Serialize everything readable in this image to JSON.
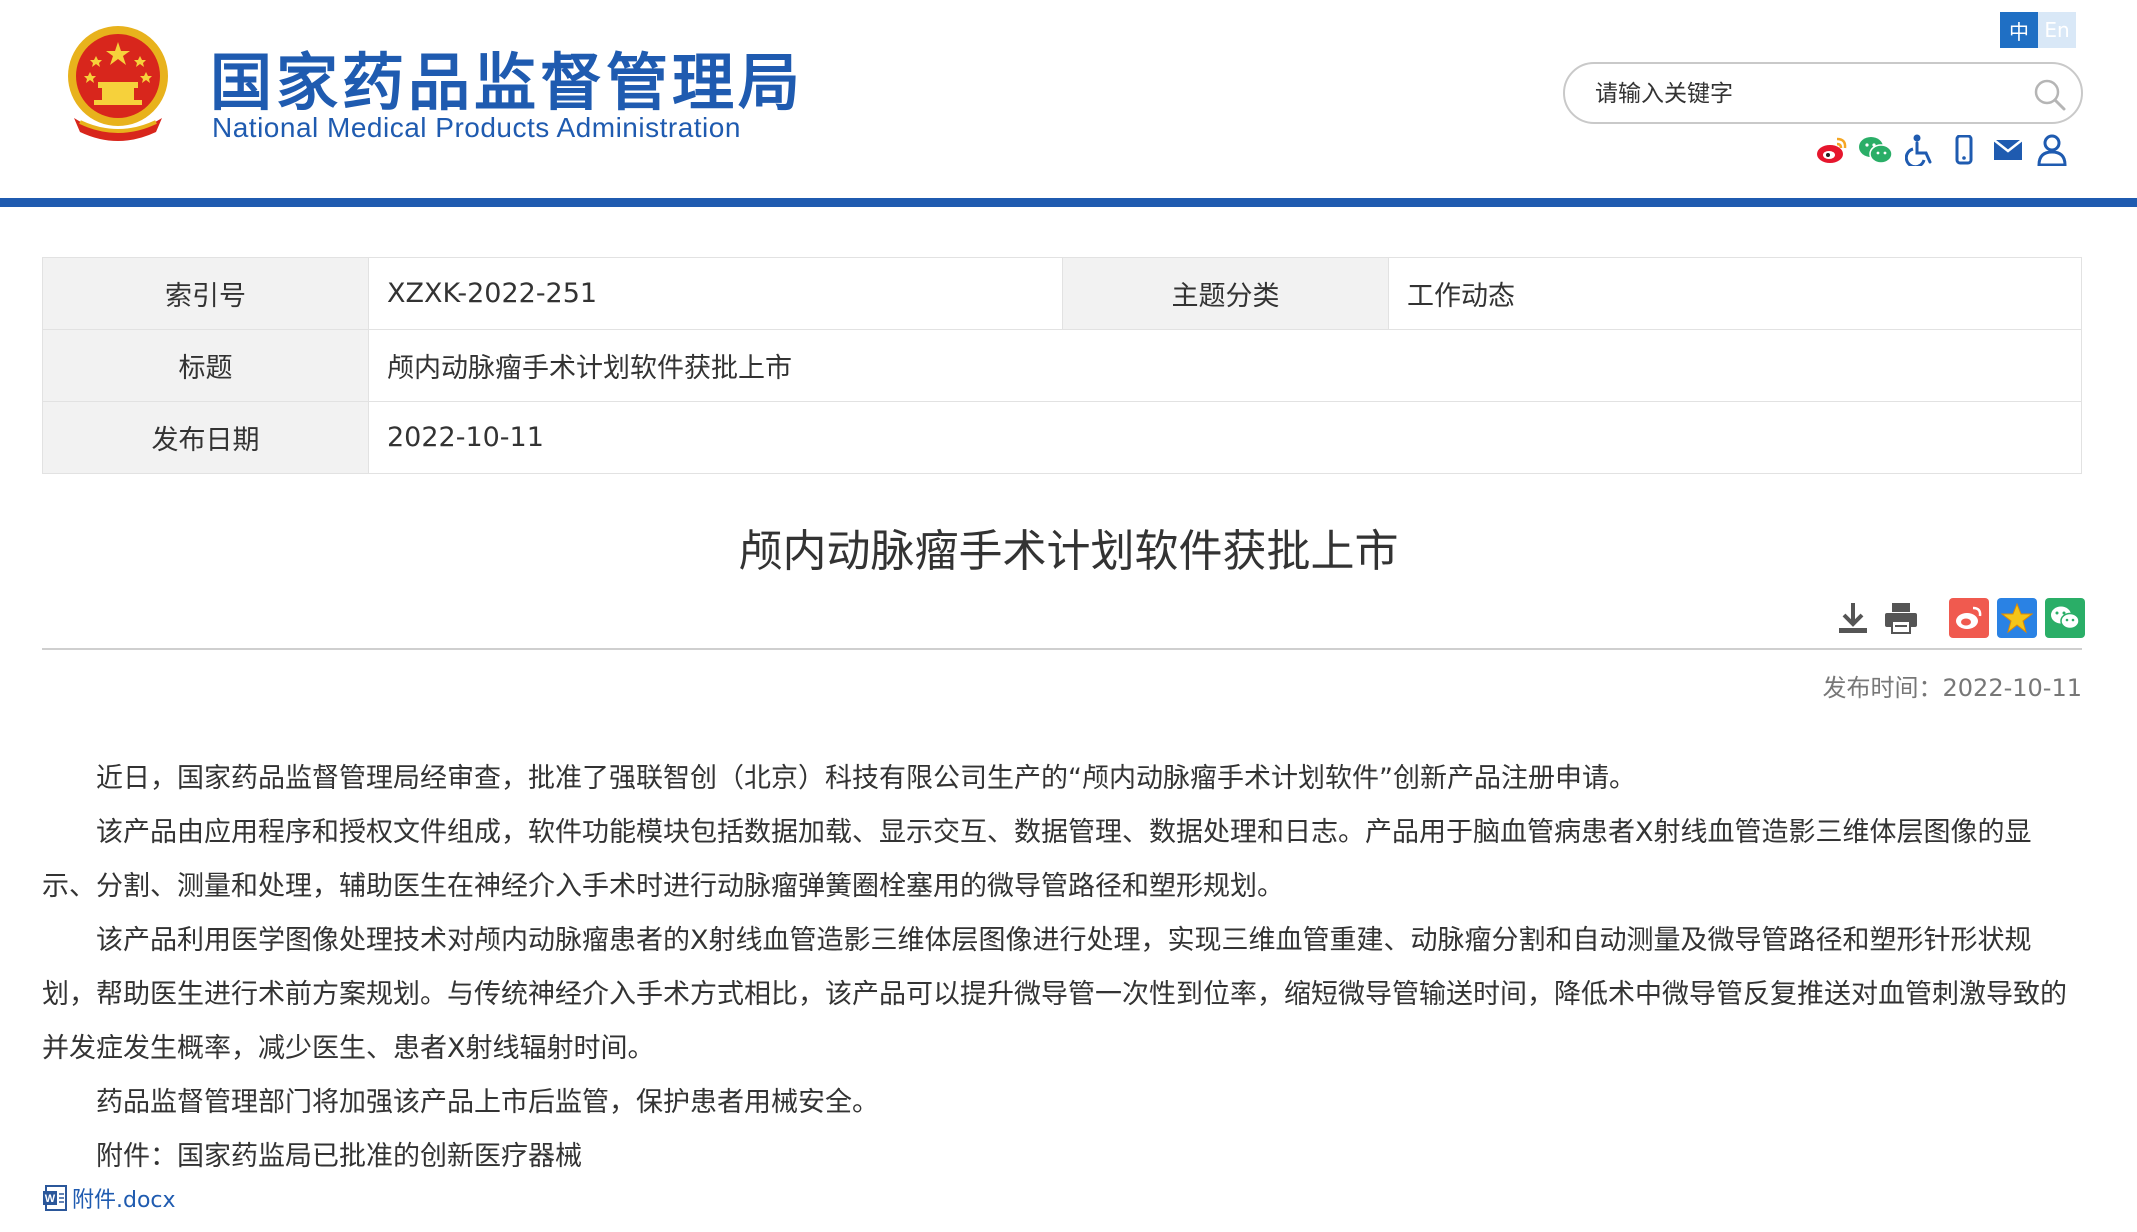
{
  "header": {
    "title_cn": "国家药品监督管理局",
    "title_en": "National Medical Products Administration",
    "lang": {
      "zh": "中",
      "en": "En"
    },
    "search": {
      "placeholder": "请输入关键字"
    },
    "icons": [
      "weibo-icon",
      "wechat-icon",
      "accessibility-icon",
      "mobile-icon",
      "mail-icon",
      "user-icon"
    ],
    "bar_color": "#1f5bb0"
  },
  "meta": {
    "index_label": "索引号",
    "index_value": "XZXK-2022-251",
    "category_label": "主题分类",
    "category_value": "工作动态",
    "title_label": "标题",
    "title_value": "颅内动脉瘤手术计划软件获批上市",
    "date_label": "发布日期",
    "date_value": "2022-10-11"
  },
  "article": {
    "title": "颅内动脉瘤手术计划软件获批上市",
    "publish_time": "发布时间：2022-10-11",
    "paragraphs": [
      "近日，国家药品监督管理局经审查，批准了强联智创（北京）科技有限公司生产的“颅内动脉瘤手术计划软件”创新产品注册申请。",
      "该产品由应用程序和授权文件组成，软件功能模块包括数据加载、显示交互、数据管理、数据处理和日志。产品用于脑血管病患者X射线血管造影三维体层图像的显示、分割、测量和处理，辅助医生在神经介入手术时进行动脉瘤弹簧圈栓塞用的微导管路径和塑形规划。",
      "该产品利用医学图像处理技术对颅内动脉瘤患者的X射线血管造影三维体层图像进行处理，实现三维血管重建、动脉瘤分割和自动测量及微导管路径和塑形针形状规划，帮助医生进行术前方案规划。与传统神经介入手术方式相比，该产品可以提升微导管一次性到位率，缩短微导管输送时间，降低术中微导管反复推送对血管刺激导致的并发症发生概率，减少医生、患者X射线辐射时间。",
      "药品监督管理部门将加强该产品上市后监管，保护患者用械安全。",
      "附件：国家药监局已批准的创新医疗器械"
    ],
    "attachment_link": "附件.docx"
  }
}
